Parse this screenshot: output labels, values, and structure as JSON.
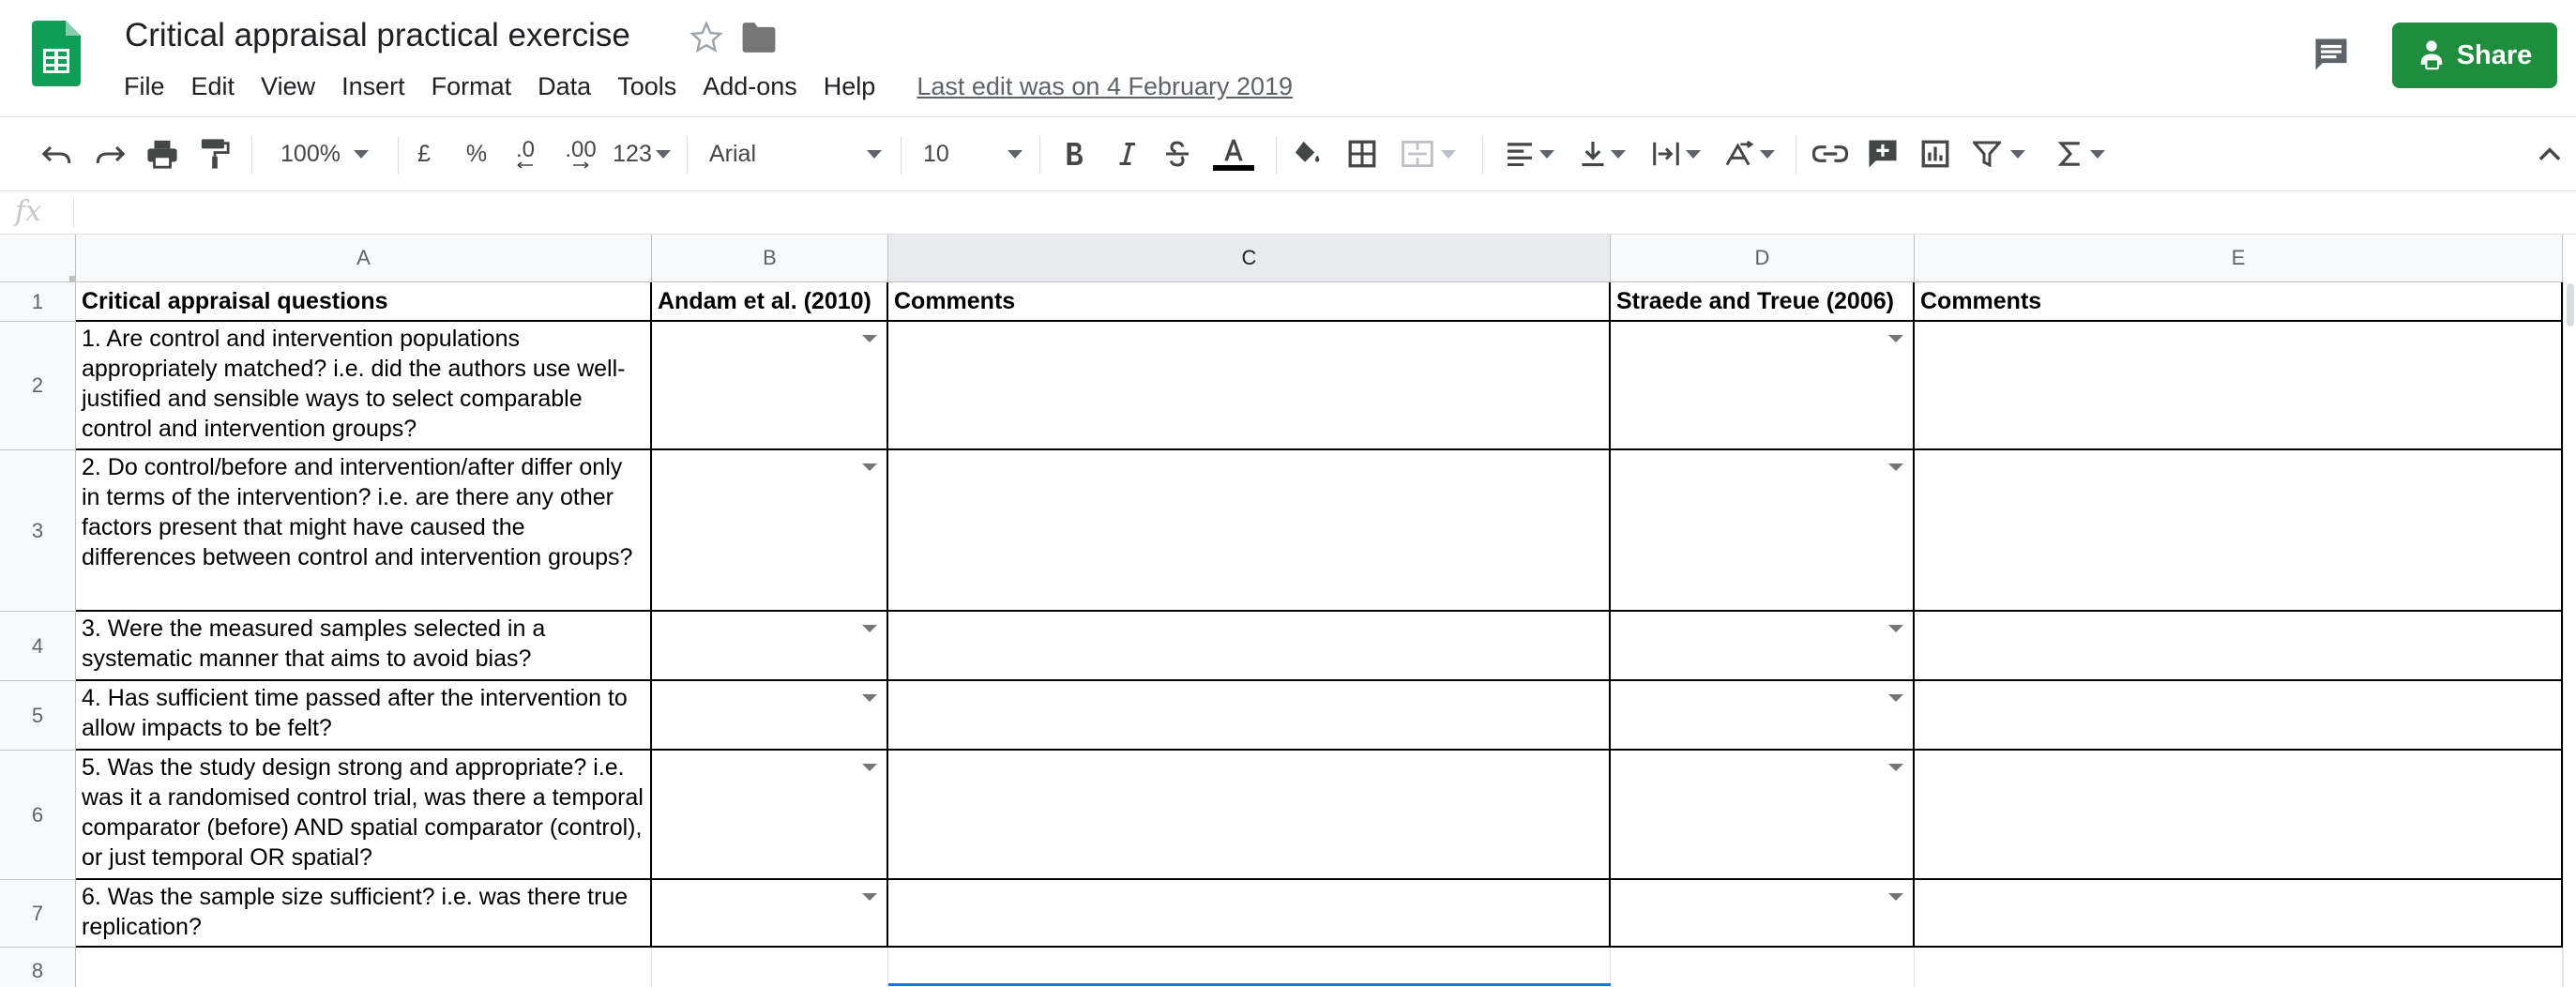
{
  "header": {
    "title": "Critical appraisal practical exercise",
    "menu": [
      "File",
      "Edit",
      "View",
      "Insert",
      "Format",
      "Data",
      "Tools",
      "Add-ons",
      "Help"
    ],
    "last_edit": "Last edit was on 4 February 2019",
    "share_label": "Share"
  },
  "toolbar": {
    "zoom": "100%",
    "currency": "£",
    "percent": "%",
    "decrease_decimal": ".0",
    "increase_decimal": ".00",
    "more_formats": "123",
    "font": "Arial",
    "font_size": "10",
    "icons": [
      "undo-icon",
      "redo-icon",
      "print-icon",
      "paint-format-icon",
      "bold-icon",
      "italic-icon",
      "strikethrough-icon",
      "text-color-icon",
      "fill-color-icon",
      "borders-icon",
      "merge-icon",
      "align-icon",
      "valign-icon",
      "wrap-icon",
      "rotate-icon",
      "link-icon",
      "comment-icon",
      "chart-icon",
      "filter-icon",
      "functions-icon",
      "collapse-icon"
    ],
    "text_color": "#000000"
  },
  "formula_bar": {
    "fx": "fx",
    "value": ""
  },
  "grid": {
    "columns": [
      "A",
      "B",
      "C",
      "D",
      "E"
    ],
    "selected_column": "C",
    "rows": [
      {
        "num": "1",
        "cells": [
          "Critical appraisal questions",
          "Andam et al. (2010)",
          "Comments",
          "Straede and Treue (2006)",
          "Comments"
        ]
      },
      {
        "num": "2",
        "cells": [
          "1. Are control and intervention populations appropriately matched? i.e. did the authors use well-justified and sensible ways to select comparable control and intervention groups?",
          "",
          "",
          "",
          ""
        ]
      },
      {
        "num": "3",
        "cells": [
          "2. Do control/before and intervention/after differ only in terms of the intervention? i.e. are there any other factors present that might have caused the differences between control and intervention groups?",
          "",
          "",
          "",
          ""
        ]
      },
      {
        "num": "4",
        "cells": [
          "3. Were the measured samples selected in a systematic manner that aims to avoid bias?",
          "",
          "",
          "",
          ""
        ]
      },
      {
        "num": "5",
        "cells": [
          "4. Has sufficient time passed after the intervention to allow impacts to be felt?",
          "",
          "",
          "",
          ""
        ]
      },
      {
        "num": "6",
        "cells": [
          "5. Was the study design strong and appropriate? i.e. was it a randomised control trial, was there a temporal comparator (before) AND spatial comparator (control), or just temporal OR spatial?",
          "",
          "",
          "",
          ""
        ]
      },
      {
        "num": "7",
        "cells": [
          "6. Was the sample size sufficient? i.e. was there true replication?",
          "",
          "",
          "",
          ""
        ]
      },
      {
        "num": "8",
        "cells": [
          "",
          "",
          "",
          "",
          ""
        ]
      }
    ]
  },
  "colors": {
    "share_button": "#1e8e3e",
    "sheets_green": "#0f9d58",
    "selection_blue": "#1a73e8"
  }
}
